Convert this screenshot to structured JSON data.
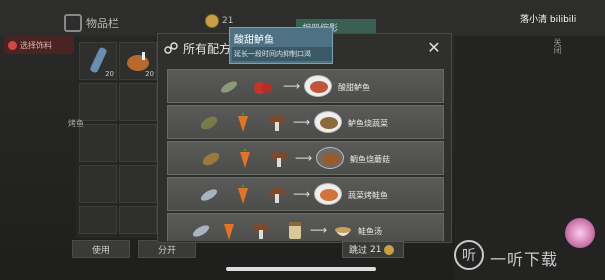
{
  "status": {
    "text": "选择饰料"
  },
  "bag_tab": {
    "label": "物品栏"
  },
  "top": {
    "coin_count": "21",
    "teal_tag": "相册缩影"
  },
  "inventory": {
    "slots": [
      {
        "count": "20"
      },
      {
        "count": "20"
      }
    ],
    "side_label": "烤鱼"
  },
  "buttons": {
    "use": "使用",
    "split": "分开"
  },
  "modal": {
    "title": "所有配方",
    "close": "✕"
  },
  "tooltip": {
    "title": "酸甜鲈鱼",
    "desc": "延长一段时间内抑制口渴"
  },
  "recipes": [
    {
      "name": "酸甜鲈鱼"
    },
    {
      "name": "鲈鱼烧蔬菜"
    },
    {
      "name": "鲷鱼烧蘑菇"
    },
    {
      "name": "蔬菜烤鲑鱼"
    },
    {
      "name": "鲑鱼汤"
    }
  ],
  "skip": {
    "label": "跳过",
    "count": "21"
  },
  "brand": {
    "text": "落小清 bilibili"
  },
  "right_vertical": "关闭",
  "watermark": {
    "icon": "听",
    "text": "一听下载"
  },
  "colors": {
    "tooltip_bg": "#4e7283",
    "row_bg": "#555653",
    "coin": "#c8a04a"
  }
}
